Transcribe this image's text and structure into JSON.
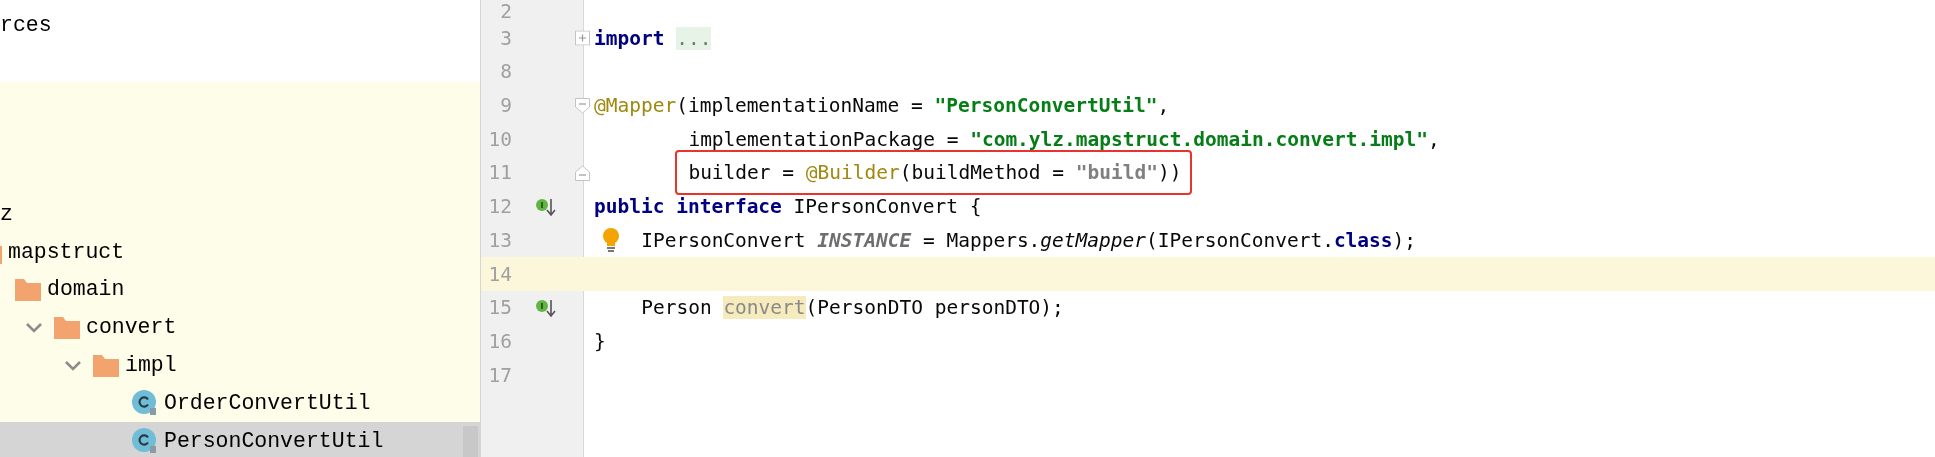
{
  "project_tree": {
    "items": [
      {
        "label": "rces",
        "selected": false
      },
      {
        "label": "z",
        "selected": false,
        "children": [
          {
            "label": "mapstruct",
            "kind": "folder",
            "selected": false,
            "children": [
              {
                "label": "domain",
                "kind": "folder",
                "selected": false,
                "children": [
                  {
                    "label": "convert",
                    "kind": "folder",
                    "expanded": true,
                    "selected": false,
                    "children": [
                      {
                        "label": "impl",
                        "kind": "folder",
                        "expanded": true,
                        "selected": false,
                        "children": [
                          {
                            "label": "OrderConvertUtil",
                            "kind": "class",
                            "selected": false
                          },
                          {
                            "label": "PersonConvertUtil",
                            "kind": "class",
                            "selected": true
                          }
                        ]
                      }
                    ]
                  }
                ]
              }
            ]
          }
        ]
      }
    ]
  },
  "editor": {
    "lines": [
      {
        "number": "2",
        "current": false
      },
      {
        "number": "3",
        "current": false,
        "fold": {
          "kind": "expand"
        },
        "tokens": [
          {
            "text": "import ",
            "kind": "keyword"
          },
          {
            "text": "...",
            "kind": "folded"
          }
        ]
      },
      {
        "number": "8",
        "current": false
      },
      {
        "number": "9",
        "current": false,
        "fold": {
          "kind": "start"
        },
        "tokens": [
          {
            "text": "@Mapper",
            "kind": "annotation"
          },
          {
            "text": "(implementationName = ",
            "kind": "plain"
          },
          {
            "text": "\"PersonConvertUtil\"",
            "kind": "string"
          },
          {
            "text": ",",
            "kind": "plain"
          }
        ]
      },
      {
        "number": "10",
        "current": false,
        "indent": {
          "kind": "continuation"
        },
        "tokens": [
          {
            "text": "implementationPackage = ",
            "kind": "plain"
          },
          {
            "text": "\"com.ylz.mapstruct.domain.convert.impl\"",
            "kind": "string"
          },
          {
            "text": ",",
            "kind": "plain"
          }
        ]
      },
      {
        "number": "11",
        "current": false,
        "fold": {
          "kind": "end"
        },
        "indent": {
          "kind": "continuation"
        },
        "boxed": true,
        "tokens": [
          {
            "text": "builder = ",
            "kind": "plain"
          },
          {
            "text": "@Builder",
            "kind": "annotation"
          },
          {
            "text": "(buildMethod = ",
            "kind": "plain"
          },
          {
            "text": "\"build\"",
            "kind": "default_string"
          },
          {
            "text": "))",
            "kind": "plain"
          }
        ]
      },
      {
        "number": "12",
        "current": false,
        "marker": {
          "kind": "implemented"
        },
        "tokens": [
          {
            "text": "public ",
            "kind": "keyword"
          },
          {
            "text": "interface ",
            "kind": "keyword"
          },
          {
            "text": "IPersonConvert {",
            "kind": "plain"
          }
        ]
      },
      {
        "number": "13",
        "current": false,
        "marker": {
          "kind": "bulb"
        },
        "indent": {
          "kind": "block"
        },
        "tokens": [
          {
            "text": "IPersonConvert ",
            "kind": "plain"
          },
          {
            "text": "INSTANCE",
            "kind": "static"
          },
          {
            "text": " = Mappers.",
            "kind": "plain"
          },
          {
            "text": "getMapper",
            "kind": "static_call"
          },
          {
            "text": "(IPersonConvert.",
            "kind": "plain"
          },
          {
            "text": "class",
            "kind": "keyword"
          },
          {
            "text": ");",
            "kind": "plain"
          }
        ]
      },
      {
        "number": "14",
        "current": true
      },
      {
        "number": "15",
        "current": false,
        "marker": {
          "kind": "implemented"
        },
        "indent": {
          "kind": "block"
        },
        "tokens": [
          {
            "text": "Person ",
            "kind": "plain"
          },
          {
            "text": "convert",
            "kind": "unused"
          },
          {
            "text": "(PersonDTO personDTO);",
            "kind": "plain"
          }
        ]
      },
      {
        "number": "16",
        "current": false,
        "tokens": [
          {
            "text": "}",
            "kind": "plain"
          }
        ]
      },
      {
        "number": "17",
        "current": false
      }
    ]
  }
}
